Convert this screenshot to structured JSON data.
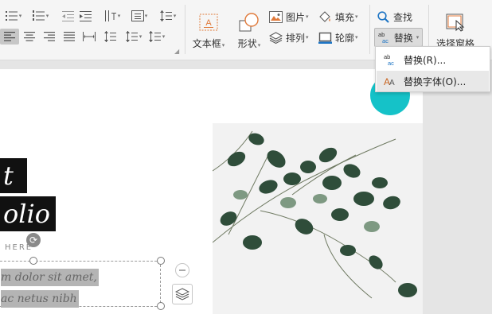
{
  "ribbon": {
    "groups": {
      "textbox_label": "文本框",
      "shape_label": "形状",
      "picture_label": "图片",
      "fill_label": "填充",
      "arrange_label": "排列",
      "outline_label": "轮廓",
      "find_label": "查找",
      "replace_label": "替换",
      "select_pane_label": "选择窗格"
    },
    "icons": [
      "bullet-list-icon",
      "numbered-list-icon",
      "decrease-indent-icon",
      "increase-indent-icon",
      "text-direction-icon",
      "align-text-icon",
      "line-spacing-icon",
      "align-left-icon",
      "align-center-icon",
      "align-right-icon",
      "justify-icon",
      "distribute-icon",
      "paragraph-spacing-icon",
      "indent-spacing-icon",
      "column-spacing-icon",
      "textbox-icon",
      "shapes-icon",
      "picture-icon",
      "fill-icon",
      "arrange-icon",
      "outline-icon",
      "search-icon",
      "replace-icon",
      "selection-pane-icon"
    ]
  },
  "menu": {
    "items": [
      {
        "label": "替换(R)...",
        "icon": "replace-text-icon"
      },
      {
        "label": "替换字体(O)...",
        "icon": "replace-font-icon"
      }
    ],
    "highlighted_index": 1
  },
  "slide": {
    "title_line1": "t",
    "title_line2": "olio",
    "subheading": "HERE",
    "body_line1": "m dolor sit amet,",
    "body_line2": "ac netus nibh",
    "accent_color": "#15c2c8"
  }
}
